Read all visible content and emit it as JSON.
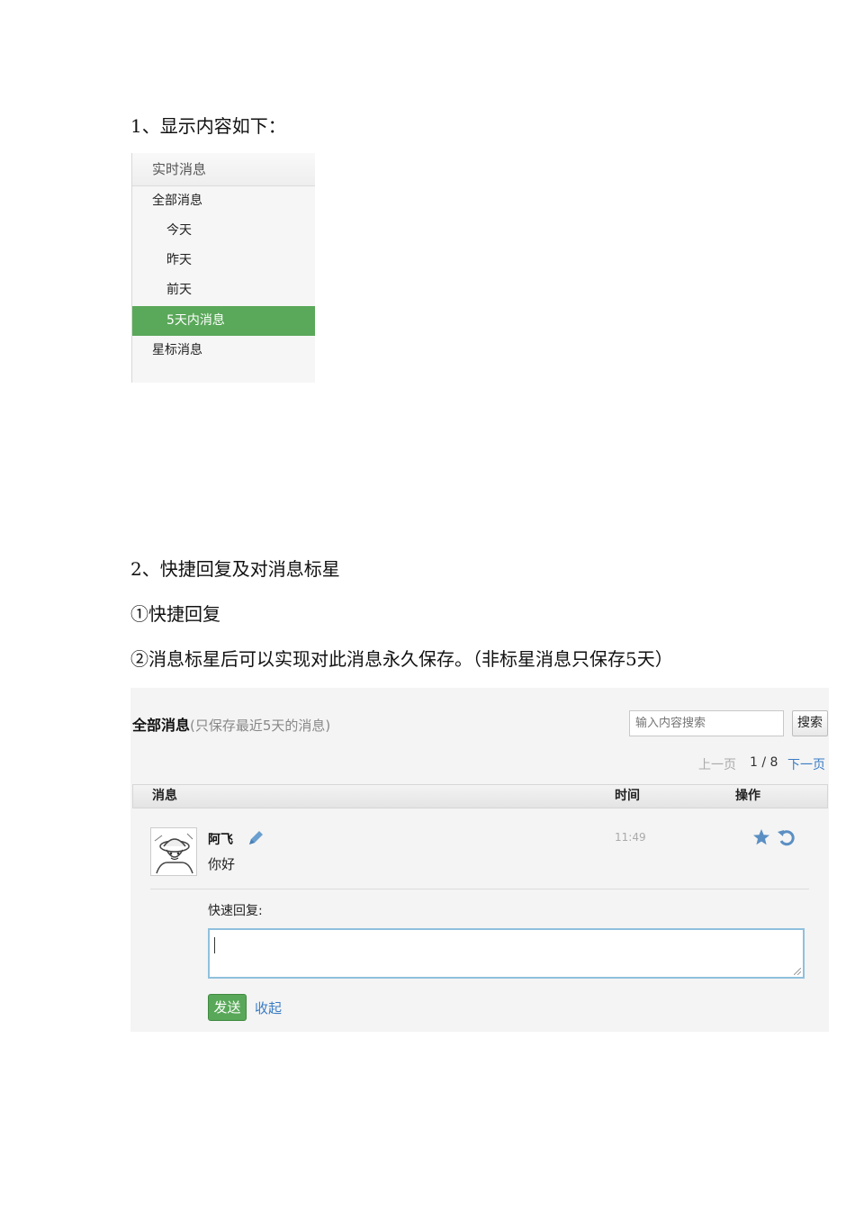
{
  "section1": {
    "heading": "1、显示内容如下："
  },
  "menu": {
    "header": "实时消息",
    "items": [
      {
        "label": "全部消息"
      },
      {
        "label": "今天"
      },
      {
        "label": "昨天"
      },
      {
        "label": "前天"
      },
      {
        "label": "5天内消息"
      },
      {
        "label": "星标消息"
      }
    ],
    "active_color": "#5aa85a"
  },
  "section2": {
    "heading": "2、快捷回复及对消息标星",
    "point1": "①快捷回复",
    "point2": "②消息标星后可以实现对此消息永久保存。（非标星消息只保存5天）"
  },
  "panel": {
    "title": "全部消息",
    "subtitle": "(只保存最近5天的消息)",
    "search_placeholder": "输入内容搜索",
    "search_button": "搜索",
    "pager": {
      "prev": "上一页",
      "count": "1 / 8",
      "next": "下一页"
    },
    "columns": {
      "message": "消息",
      "time": "时间",
      "action": "操作"
    },
    "message": {
      "sender": "阿飞",
      "text": "你好",
      "time": "11:49",
      "avatar_icon": "avatar-manga-icon",
      "edit_icon": "pencil-icon",
      "star_icon": "star-icon",
      "reply_icon": "reply-icon"
    },
    "reply": {
      "label": "快速回复:",
      "send_button": "发送",
      "collapse_link": "收起"
    },
    "colors": {
      "accent_green": "#59a85a",
      "link_blue": "#3a7cc4",
      "input_border": "#8fc0dd"
    }
  }
}
